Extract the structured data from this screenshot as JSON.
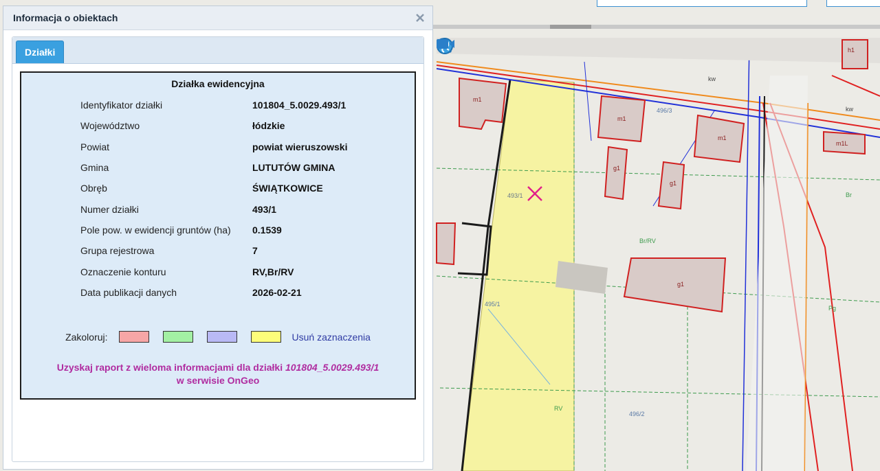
{
  "panel": {
    "title": "Informacja o obiektach",
    "tabs": [
      {
        "label": "Działki"
      }
    ],
    "heading": "Działka ewidencyjna",
    "rows": [
      {
        "label": "Identyfikator działki",
        "value": "101804_5.0029.493/1"
      },
      {
        "label": "Województwo",
        "value": "łódzkie"
      },
      {
        "label": "Powiat",
        "value": "powiat wieruszowski"
      },
      {
        "label": "Gmina",
        "value": "LUTUTÓW GMINA"
      },
      {
        "label": "Obręb",
        "value": "ŚWIĄTKOWICE"
      },
      {
        "label": "Numer działki",
        "value": "493/1"
      },
      {
        "label": "Pole pow. w ewidencji gruntów (ha)",
        "value": "0.1539"
      },
      {
        "label": "Grupa rejestrowa",
        "value": "7"
      },
      {
        "label": "Oznaczenie konturu",
        "value": "RV,Br/RV"
      },
      {
        "label": "Data publikacji danych",
        "value": "2026-02-21"
      }
    ],
    "colorize": {
      "label": "Zakoloruj:",
      "swatches": [
        "#f7a6a6",
        "#a3f0a3",
        "#b9b9f5",
        "#fdfd7a"
      ],
      "clear_label": "Usuń zaznaczenia"
    },
    "report": {
      "prefix": "Uzyskaj raport z wieloma informacjami dla działki",
      "parcel_id": "101804_5.0029.493/1",
      "suffix": "w serwisie OnGeo"
    }
  },
  "map": {
    "tools": [
      {
        "icon": "zoom-icon"
      },
      {
        "icon": "globe-icon"
      },
      {
        "icon": "video-camera-icon"
      }
    ],
    "labels": {
      "parcel_4931": "493/1",
      "parcel_4963": "496/3",
      "parcel_4951": "495/1",
      "parcel_4962": "496/2",
      "contour_rv": "RV",
      "contour_br": "Br/RV",
      "bld_m1": "m1",
      "bld_g1": "g1",
      "bld_h1": "h1",
      "bld_m1b": "m1L",
      "small_kw": "kw",
      "small_pg": "Pg",
      "small_br": "Br"
    }
  },
  "colors": {
    "parcel_highlight": "#f6f3a2",
    "accent": "#3aa0e0",
    "report_text": "#b02ca0",
    "clear_link": "#2e3aa3"
  }
}
